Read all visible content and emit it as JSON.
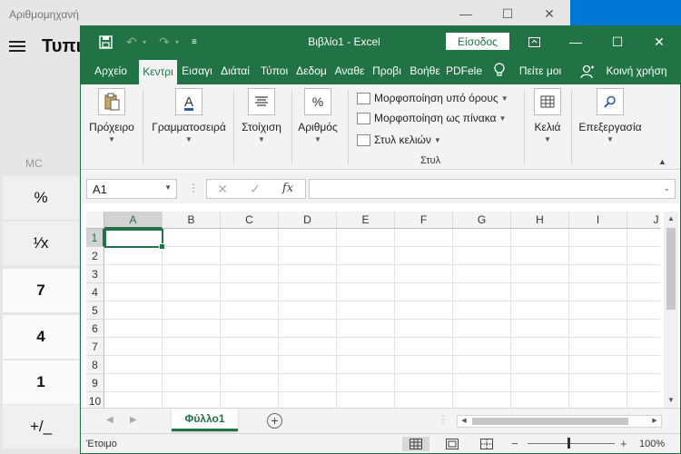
{
  "calculator": {
    "title": "Αριθμομηχανή",
    "mode": "Τυπικ",
    "memory_label": "MC",
    "keys": [
      {
        "label": "%",
        "kind": "op"
      },
      {
        "label": "¹∕x",
        "kind": "op"
      },
      {
        "label": "7",
        "kind": "num"
      },
      {
        "label": "4",
        "kind": "num"
      },
      {
        "label": "1",
        "kind": "num"
      },
      {
        "label": "+/_",
        "kind": "op"
      }
    ]
  },
  "excel": {
    "doc_title": "Βιβλίο1  -  Excel",
    "signin_label": "Είσοδος",
    "tabs": [
      "Αρχείο",
      "Κεντρι",
      "Εισαγι",
      "Διάταί",
      "Τύποι",
      "Δεδομ",
      "Αναθε",
      "Προβι",
      "Βοήθε",
      "PDFele"
    ],
    "active_tab": "Κεντρι",
    "tell_me": "Πείτε μοι",
    "share": "Κοινή χρήση",
    "ribbon": {
      "clipboard": "Πρόχειρο",
      "font": "Γραμματοσειρά",
      "alignment": "Στοίχιση",
      "number": "Αριθμός",
      "number_icon": "%",
      "conditional_formatting": "Μορφοποίηση υπό όρους",
      "format_as_table": "Μορφοποίηση ως πίνακα",
      "cell_styles": "Στυλ κελιών",
      "styles_group": "Στυλ",
      "cells": "Κελιά",
      "editing": "Επεξεργασία"
    },
    "name_box": "A1",
    "fx_label": "fx",
    "columns": [
      "A",
      "B",
      "C",
      "D",
      "E",
      "F",
      "G",
      "H",
      "I",
      "J"
    ],
    "rows": [
      "1",
      "2",
      "3",
      "4",
      "5",
      "6",
      "7",
      "8",
      "9",
      "10"
    ],
    "sheet_tab": "Φύλλο1",
    "status": "Έτοιμο",
    "zoom": "100%",
    "accent": "#217346"
  }
}
